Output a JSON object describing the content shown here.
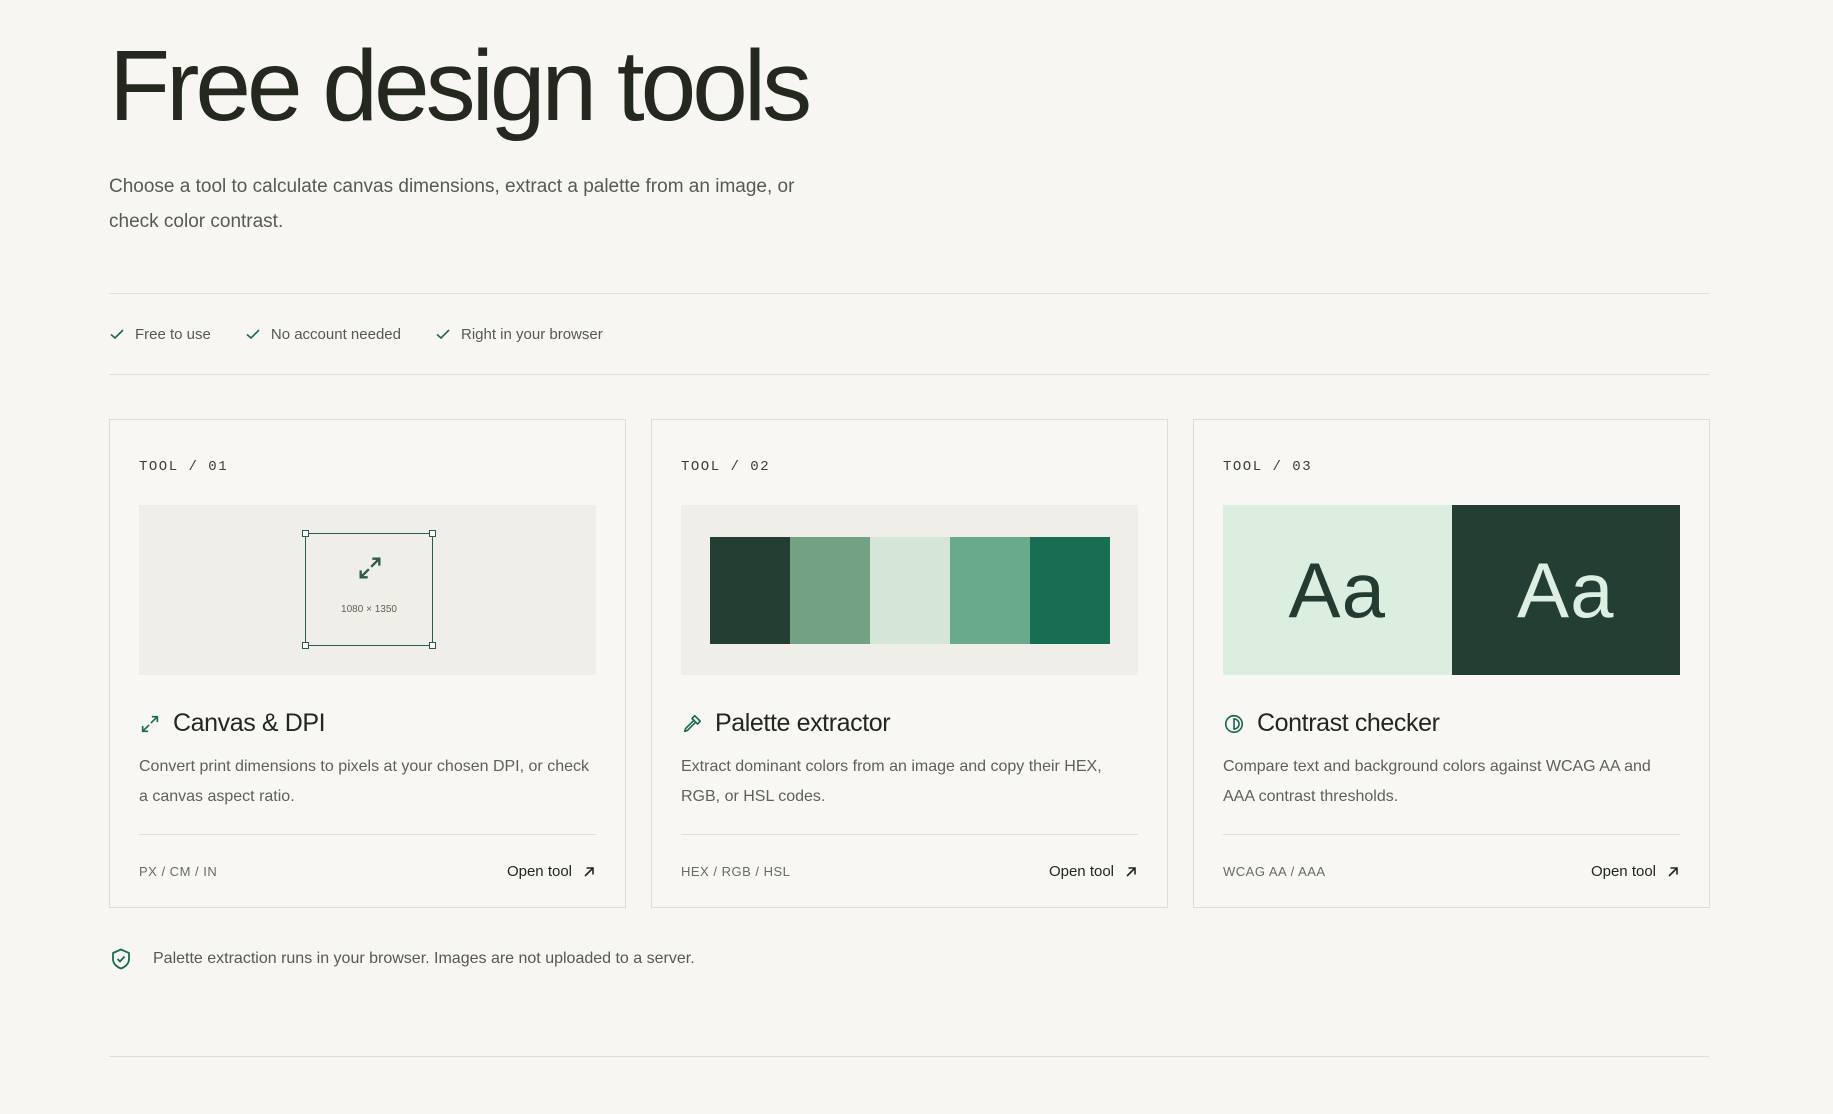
{
  "header": {
    "title": "Free design tools",
    "lead": "Choose a tool to calculate canvas dimensions, extract a palette from an image, or check color contrast."
  },
  "features": [
    "Free to use",
    "No account needed",
    "Right in your browser"
  ],
  "cards": [
    {
      "eyebrow": "TOOL / 01",
      "title": "Canvas & DPI",
      "icon": "resize-arrows-icon",
      "description": "Convert print dimensions to pixels at your chosen DPI, or check a canvas aspect ratio.",
      "units": "PX / CM / IN",
      "link": "Open tool",
      "visual_label": "1080 × 1350"
    },
    {
      "eyebrow": "TOOL / 02",
      "title": "Palette extractor",
      "icon": "eyedropper-icon",
      "description": "Extract dominant colors from an image and copy their HEX, RGB, or HSL codes.",
      "units": "HEX / RGB / HSL",
      "link": "Open tool",
      "swatches": [
        "#233f33",
        "#72a283",
        "#d5e6d8",
        "#68aa8a",
        "#186e52"
      ]
    },
    {
      "eyebrow": "TOOL / 03",
      "title": "Contrast checker",
      "icon": "contrast-icon",
      "description": "Compare text and background colors against WCAG AA and AAA contrast thresholds.",
      "units": "WCAG AA / AAA",
      "link": "Open tool",
      "samples": [
        {
          "text": "Aa",
          "bg": "#dbeee0",
          "fg": "#233b31"
        },
        {
          "text": "Aa",
          "bg": "#233f33",
          "fg": "#ddeee2"
        }
      ]
    }
  ],
  "note": "Palette extraction runs in your browser. Images are not uploaded to a server.",
  "colors": {
    "accent": "#1c6b50",
    "background": "#f7f6f2"
  }
}
